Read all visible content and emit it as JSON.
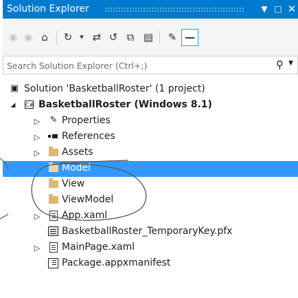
{
  "window": {
    "title": "Solution Explorer",
    "pin_dropdown_icon": "dropdown-arrow",
    "maximize_icon": "maximize",
    "close_icon": "close"
  },
  "toolbar": {
    "icons": [
      "back",
      "forward",
      "home",
      "pending-changes-filter",
      "dropdown",
      "sync-with-active-document",
      "refresh",
      "collapse-all",
      "show-all-files",
      "properties",
      "preview-selected-items"
    ]
  },
  "search": {
    "placeholder": "Search Solution Explorer (Ctrl+;)",
    "value": ""
  },
  "tree": {
    "solution": "Solution 'BasketballRoster' (1 project)",
    "project": "BasketballRoster (Windows 8.1)",
    "items": {
      "properties": "Properties",
      "references": "References",
      "assets": "Assets",
      "model": "Model",
      "view": "View",
      "viewmodel": "ViewModel",
      "appxaml": "App.xaml",
      "pfx": "BasketballRoster_TemporaryKey.pfx",
      "mainpage": "MainPage.xaml",
      "manifest": "Package.appxmanifest"
    },
    "selected": "Model"
  },
  "colors": {
    "title_bar": "#007acc",
    "selection": "#3399ff",
    "folder": "#dcb67a"
  }
}
